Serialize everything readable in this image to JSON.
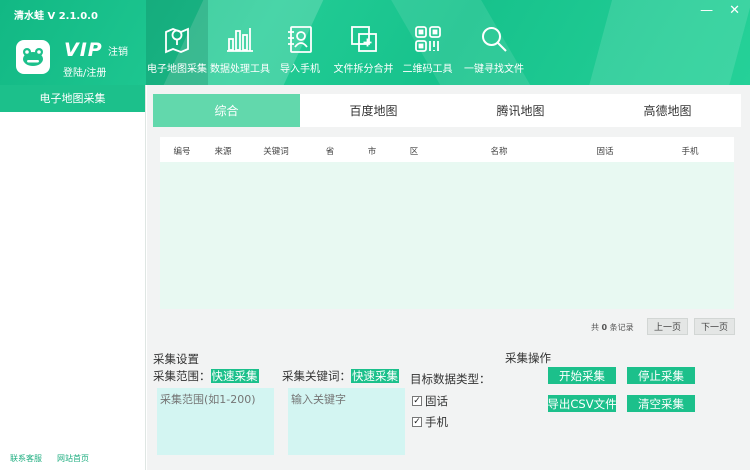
{
  "app": {
    "title": "清水蛙  V 2.1.0.0",
    "vip": "VIP",
    "logout": "注销",
    "login": "登陆/注册"
  },
  "window": {
    "minimize": "—",
    "close": "✕"
  },
  "toolbar": [
    {
      "label": "电子地图采集",
      "icon": "map-pin-icon"
    },
    {
      "label": "数据处理工具",
      "icon": "bar-chart-icon"
    },
    {
      "label": "导入手机",
      "icon": "contact-card-icon"
    },
    {
      "label": "文件拆分合并",
      "icon": "split-merge-icon"
    },
    {
      "label": "二维码工具",
      "icon": "qr-code-icon"
    },
    {
      "label": "一键寻找文件",
      "icon": "search-icon"
    }
  ],
  "sidebar": {
    "active": "电子地图采集",
    "links": [
      "联系客服",
      "网站首页"
    ]
  },
  "tabs": [
    "综合",
    "百度地图",
    "腾讯地图",
    "高德地图"
  ],
  "table": {
    "columns": [
      "编号",
      "来源",
      "关键词",
      "省",
      "市",
      "区",
      "名称",
      "固话",
      "手机"
    ]
  },
  "pager": {
    "prefix": "共",
    "count": "0",
    "suffix": "条记录",
    "prev": "上一页",
    "next": "下一页"
  },
  "settings": {
    "title": "采集设置",
    "range_label": "采集范围：",
    "range_tag": "快速采集",
    "range_placeholder": "采集范围(如1-200)",
    "keyword_label": "采集关键词：",
    "keyword_tag": "快速采集",
    "keyword_placeholder": "输入关键字",
    "type_label": "目标数据类型：",
    "types": [
      {
        "label": "固话",
        "checked": true
      },
      {
        "label": "手机",
        "checked": true
      }
    ]
  },
  "operations": {
    "title": "采集操作",
    "start": "开始采集",
    "stop": "停止采集",
    "export": "导出CSV文件",
    "clear": "清空采集"
  },
  "colors": {
    "brand": "#1cc08b",
    "tab_active": "#62d8ac",
    "table_body": "#e8f9f2",
    "textarea": "#d3f5f2"
  }
}
